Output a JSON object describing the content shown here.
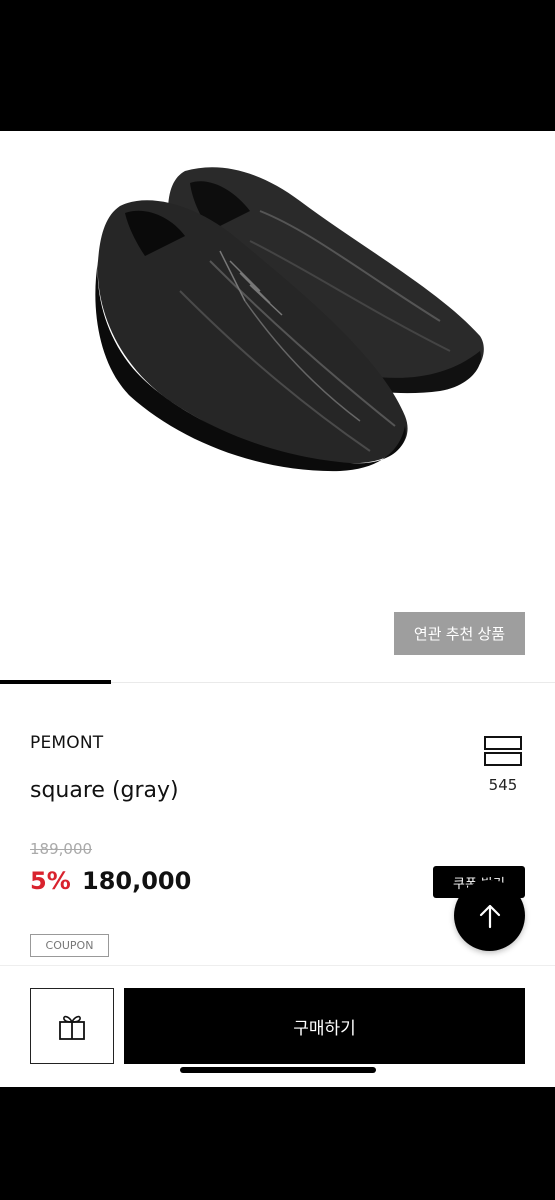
{
  "related_button": "연관 추천 상품",
  "product": {
    "brand": "PEMONT",
    "name": "square (gray)",
    "wish_count": "545",
    "original_price": "189,000",
    "discount_rate": "5%",
    "sale_price": "180,000",
    "coupon_button": "쿠폰 받기",
    "coupon_badge": "COUPON"
  },
  "footer": {
    "buy_button": "구매하기"
  },
  "icons": {
    "wish": "stacked-rectangles-icon",
    "scroll_top": "arrow-up-icon",
    "gift": "gift-icon"
  },
  "colors": {
    "discount": "#d9232e",
    "related_button_bg": "#9e9e9e",
    "primary": "#000000"
  }
}
